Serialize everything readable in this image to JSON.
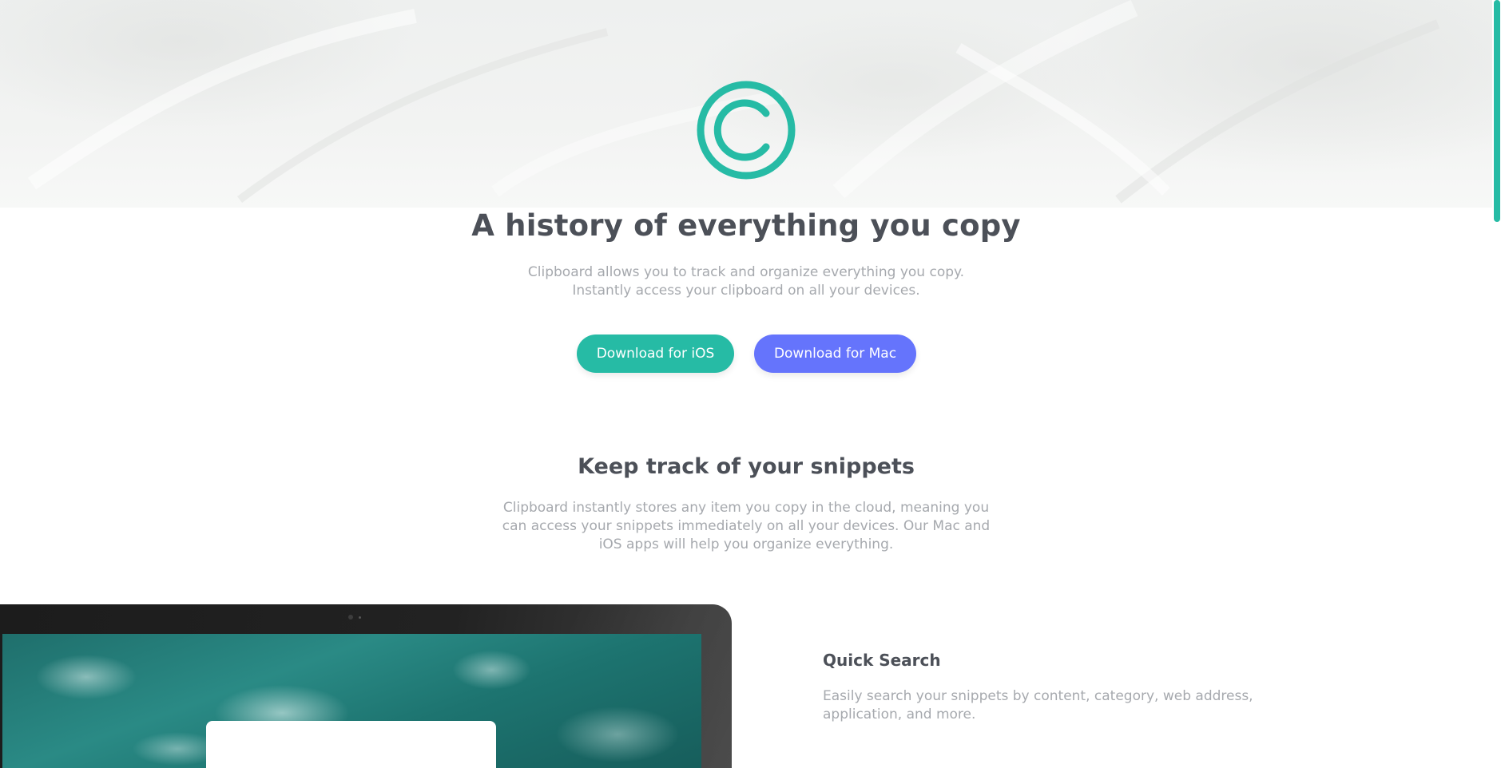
{
  "hero": {
    "logo_icon": "clipboard-copyright-logo",
    "title": "A history of everything you copy",
    "subtitle_line1": "Clipboard allows you to track and organize everything you copy.",
    "subtitle_line2": "Instantly access your clipboard on all your devices."
  },
  "buttons": {
    "ios_label": "Download for iOS",
    "mac_label": "Download for Mac"
  },
  "snippets": {
    "title": "Keep track of your snippets",
    "text_line1": "Clipboard instantly stores any item you copy in the cloud, meaning you",
    "text_line2": "can access your snippets immediately on all your devices. Our Mac and",
    "text_line3": "iOS apps will help you organize everything."
  },
  "features": [
    {
      "title": "Quick Search",
      "text_line1": "Easily search your snippets by content, category, web address,",
      "text_line2": "application, and more."
    }
  ],
  "colors": {
    "primary": "#26bba5",
    "secondary": "#6574fc",
    "heading": "#4c5058",
    "body_text": "#a6a9ae"
  }
}
